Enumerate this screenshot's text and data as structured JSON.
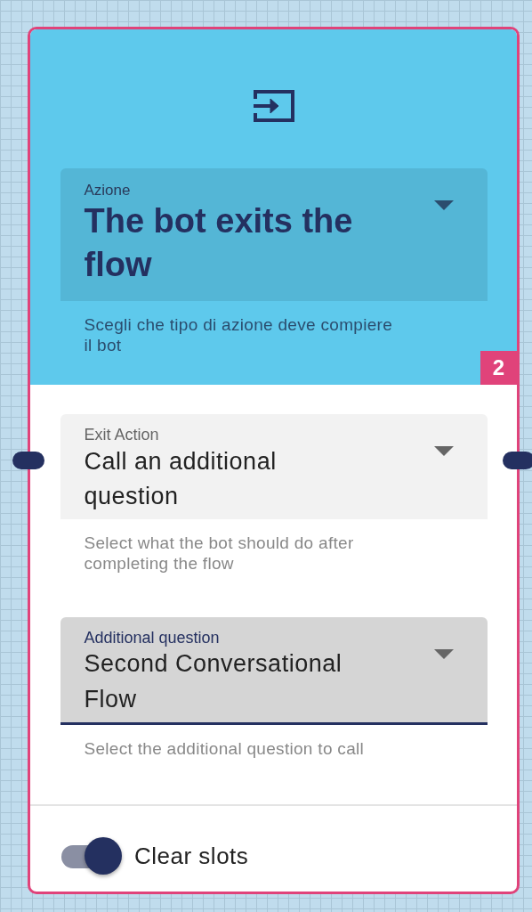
{
  "node": {
    "badge": "2",
    "header_field": {
      "label": "Azione",
      "value": "The bot exits the flow",
      "helper": "Scegli che tipo di azione deve compiere il bot"
    },
    "fields": [
      {
        "label": "Exit Action",
        "value": "Call an additional question",
        "helper": "Select what the bot should do after completing the flow",
        "focused": false
      },
      {
        "label": "Additional question",
        "value": "Second Conversational Flow",
        "helper": "Select the additional question to call",
        "focused": true
      }
    ],
    "toggle": {
      "label": "Clear slots",
      "on": true
    }
  }
}
